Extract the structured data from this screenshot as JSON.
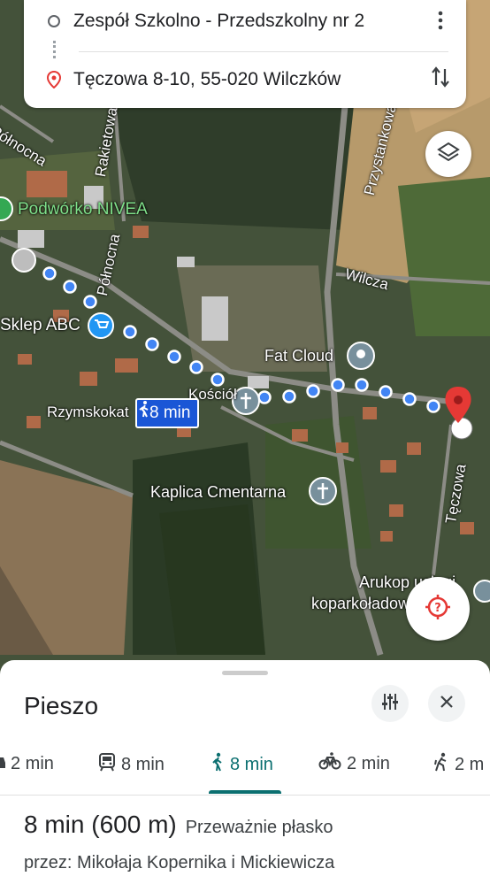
{
  "search": {
    "origin": "Zespół Szkolno - Przedszkolny nr 2",
    "destination": "Tęczowa 8-10, 55-020 Wilczków"
  },
  "map": {
    "labels": {
      "polnocna_top": "Północna",
      "rakietowa": "Rakietowa",
      "podworko": "Podwórko NIVEA",
      "polnocna": "Północna",
      "sklep": "Sklep ABC",
      "rzymskokat": "Rzymskokat",
      "kosciol": "Kościół",
      "fatcloud": "Fat Cloud",
      "wilcza": "Wilcza",
      "przystankowa": "Przystankowa",
      "kaplica": "Kaplica Cmentarna",
      "teczowa": "Tęczowa",
      "arukop1": "Arukop usługi",
      "arukop2": "koparkoładowarką"
    },
    "route_badge": "8 min"
  },
  "sheet": {
    "title": "Pieszo",
    "modes": [
      {
        "icon": "car-icon",
        "label": "2 min"
      },
      {
        "icon": "train-icon",
        "label": "8 min"
      },
      {
        "icon": "walk-icon",
        "label": "8 min"
      },
      {
        "icon": "bike-icon",
        "label": "2 min"
      },
      {
        "icon": "ride-icon",
        "label": "2 m"
      }
    ],
    "selected_mode": "walk",
    "summary_time": "8 min (600 m)",
    "summary_note": "Przeważnie płasko",
    "via": "przez: Mikołaja Kopernika i Mickiewicza"
  },
  "colors": {
    "route": "#1a56d6",
    "accent": "#0b6f70",
    "pin": "#e53935"
  }
}
